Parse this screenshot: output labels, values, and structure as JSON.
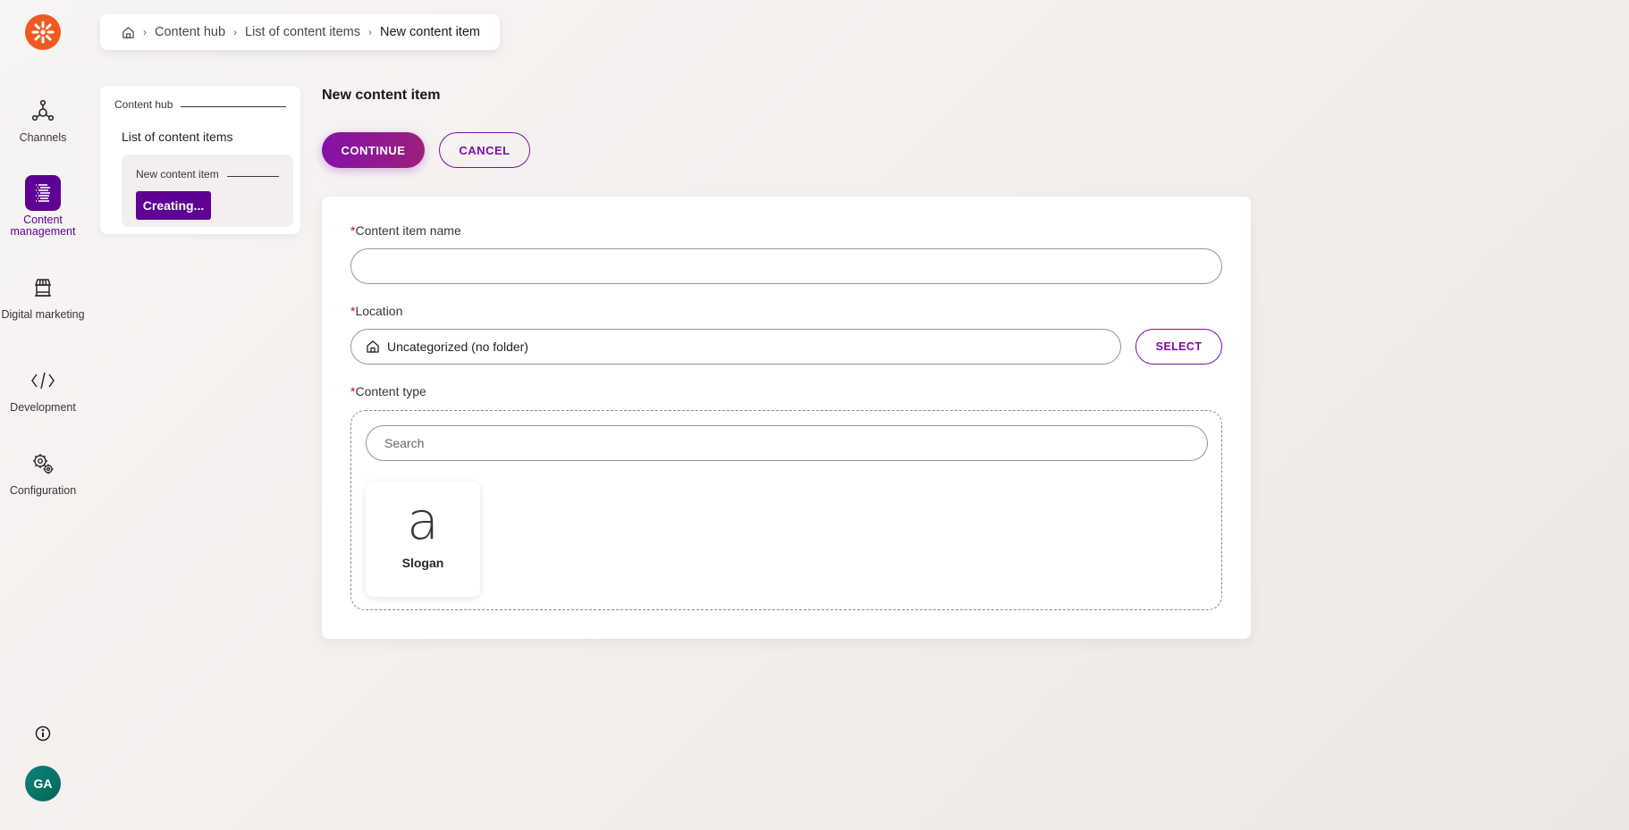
{
  "app": {
    "logo_icon": "kentico-logo-icon",
    "brand_color": "#f05a22",
    "accent_color": "#5f0095"
  },
  "rail": {
    "items": [
      {
        "label": "Channels",
        "icon": "channels-icon",
        "active": false
      },
      {
        "label": "Content management",
        "icon": "content-management-icon",
        "active": true
      },
      {
        "label": "Digital marketing",
        "icon": "storefront-icon",
        "active": false
      },
      {
        "label": "Development",
        "icon": "code-icon",
        "active": false
      },
      {
        "label": "Configuration",
        "icon": "gears-icon",
        "active": false
      }
    ],
    "info_icon": "info-icon",
    "avatar_initials": "GA"
  },
  "breadcrumb": {
    "home_icon": "home-icon",
    "items": [
      "Content hub",
      "List of content items",
      "New content item"
    ]
  },
  "tree": {
    "root": "Content hub",
    "list": "List of content items",
    "current": "New content item",
    "status_chip": "Creating..."
  },
  "main": {
    "title": "New content item",
    "continue_label": "CONTINUE",
    "cancel_label": "CANCEL",
    "form": {
      "required_marker": "*",
      "name_label": "Content item name",
      "name_value": "",
      "location_label": "Location",
      "location_value": "Uncategorized (no folder)",
      "select_label": "SELECT",
      "content_type_label": "Content type",
      "search_placeholder": "Search",
      "content_types": [
        {
          "glyph": "a",
          "name": "Slogan"
        }
      ]
    }
  }
}
